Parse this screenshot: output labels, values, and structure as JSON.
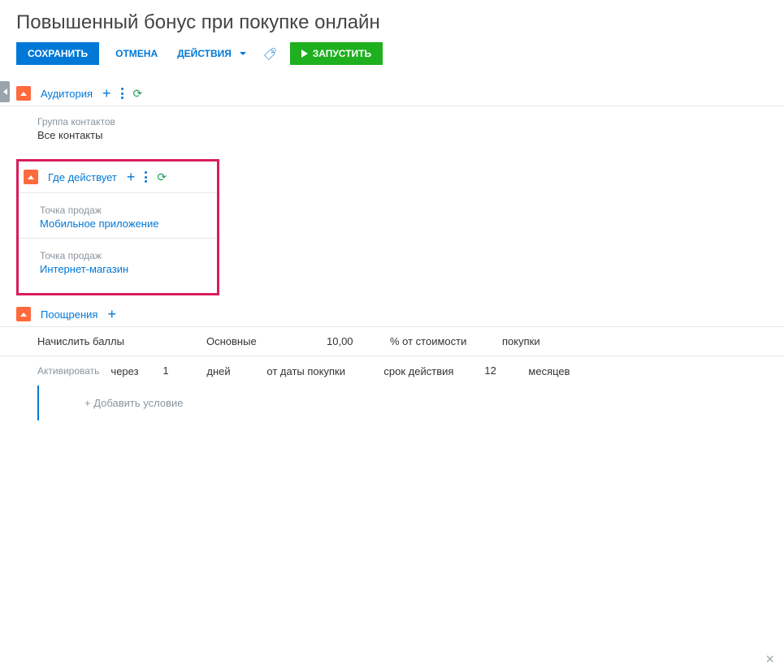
{
  "pageTitle": "Повышенный бонус при покупке онлайн",
  "toolbar": {
    "save": "СОХРАНИТЬ",
    "cancel": "ОТМЕНА",
    "actions": "ДЕЙСТВИЯ",
    "run": "ЗАПУСТИТЬ"
  },
  "sections": {
    "audience": {
      "title": "Аудитория",
      "groupLabel": "Группа контактов",
      "groupValue": "Все контакты"
    },
    "where": {
      "title": "Где действует",
      "items": [
        {
          "label": "Точка продаж",
          "value": "Мобильное приложение"
        },
        {
          "label": "Точка продаж",
          "value": "Интернет-магазин"
        }
      ]
    },
    "rewards": {
      "title": "Поощрения",
      "row1": {
        "action": "Начислить баллы",
        "type": "Основные",
        "amount": "10,00",
        "unit": "% от стоимости",
        "of": "покупки"
      },
      "row2": {
        "activateLabel": "Активировать",
        "after": "через",
        "days": "1",
        "daysLabel": "дней",
        "from": "от даты покупки",
        "validLabel": "срок действия",
        "validValue": "12",
        "validUnit": "месяцев"
      },
      "addCondition": "+  Добавить условие"
    }
  }
}
